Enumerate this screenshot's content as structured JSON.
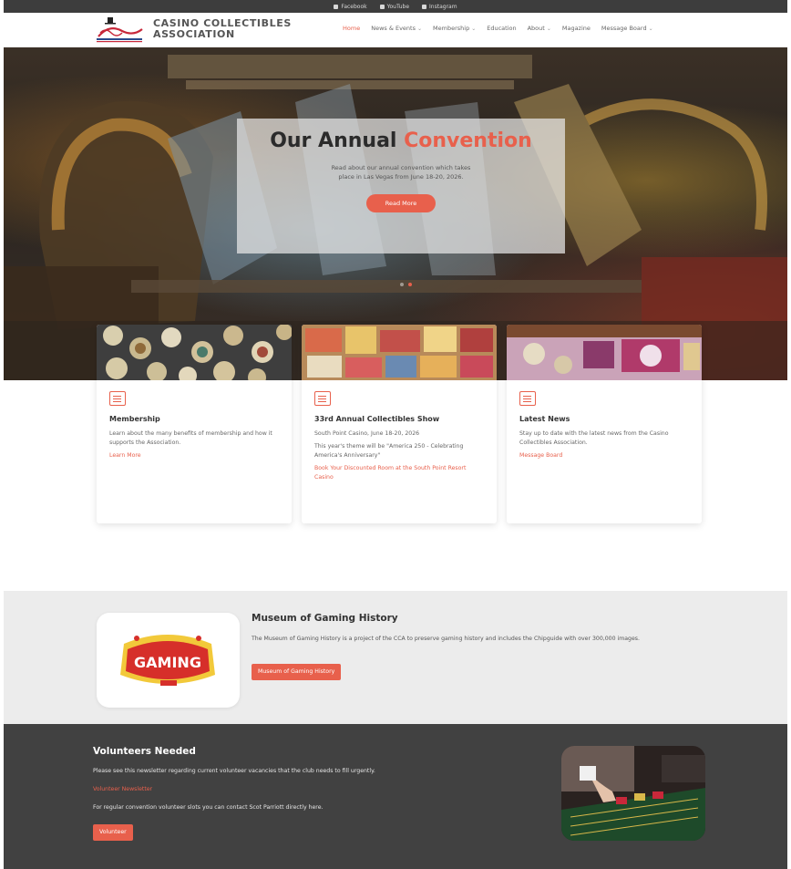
{
  "topbar": {
    "social": [
      {
        "label": "Facebook",
        "icon": "facebook-icon"
      },
      {
        "label": "YouTube",
        "icon": "youtube-icon"
      },
      {
        "label": "Instagram",
        "icon": "instagram-icon"
      }
    ]
  },
  "header": {
    "brand_line1": "CASINO COLLECTIBLES",
    "brand_line2": "ASSOCIATION",
    "nav": [
      {
        "label": "Home",
        "active": true,
        "dropdown": false
      },
      {
        "label": "News & Events",
        "active": false,
        "dropdown": true
      },
      {
        "label": "Membership",
        "active": false,
        "dropdown": true
      },
      {
        "label": "Education",
        "active": false,
        "dropdown": false
      },
      {
        "label": "About",
        "active": false,
        "dropdown": true
      },
      {
        "label": "Magazine",
        "active": false,
        "dropdown": false
      },
      {
        "label": "Message Board",
        "active": false,
        "dropdown": true
      }
    ]
  },
  "hero": {
    "title_main": "Our Annual ",
    "title_accent": "Convention",
    "text": "Read about our annual convention which takes place in Las Vegas from June 18-20, 2026.",
    "button": "Read More"
  },
  "cards": [
    {
      "title": "Membership",
      "text1": "Learn about the many benefits of membership and how it supports the Association.",
      "text2": "",
      "link": "Learn More"
    },
    {
      "title": "33rd Annual Collectibles Show",
      "text1": "South Point Casino, June 18-20, 2026",
      "text2": "This year's theme will be \"America 250 - Celebrating America's Anniversary\"",
      "link": "Book Your Discounted Room at the South Point Resort Casino"
    },
    {
      "title": "Latest News",
      "text1": "Stay up to date with the latest news from the Casino Collectibles Association.",
      "text2": "",
      "link": "Message Board"
    }
  ],
  "museum": {
    "title": "Museum of Gaming History",
    "text": "The Museum of Gaming History is a project of the CCA to preserve gaming history and includes the Chipguide with over 300,000 images.",
    "button": "Museum of Gaming History",
    "logo_text": "GAMING"
  },
  "volunteers": {
    "title": "Volunteers Needed",
    "text1": "Please see this newsletter regarding current volunteer vacancies that the club needs to fill urgently.",
    "link": "Volunteer Newsletter",
    "text2": "For regular convention volunteer slots you can contact Scot Parriott directly here.",
    "button": "Volunteer"
  },
  "colors": {
    "accent": "#e8604c",
    "dark": "#414141",
    "light_gray": "#ececec"
  }
}
